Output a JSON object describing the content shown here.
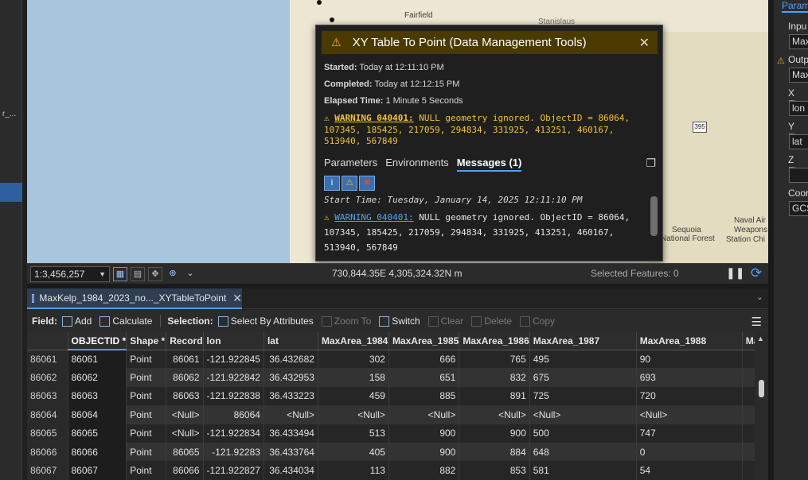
{
  "left_panel": {
    "truncated_text": "r_..."
  },
  "map": {
    "labels": [
      "Fairfield",
      "Stanislaus",
      "Sequoia",
      "National Forest",
      "Naval Air",
      "Weapons",
      "Station Chi"
    ],
    "road_shield": "395"
  },
  "map_status": {
    "scale": "1:3,456,257",
    "coordinates": "730,844.35E 4,305,324.32N m",
    "selected_features": "Selected Features: 0"
  },
  "table_tab": {
    "label": "MaxKelp_1984_2023_no..._XYTableToPoint"
  },
  "toolbar": {
    "field_label": "Field:",
    "add": "Add",
    "calculate": "Calculate",
    "selection_label": "Selection:",
    "select_by_attributes": "Select By Attributes",
    "zoom_to": "Zoom To",
    "switch": "Switch",
    "clear": "Clear",
    "delete": "Delete",
    "copy": "Copy"
  },
  "table": {
    "columns": [
      "",
      "OBJECTID *",
      "Shape *",
      "Record",
      "lon",
      "lat",
      "MaxArea_1984",
      "MaxArea_1985",
      "MaxArea_1986",
      "MaxArea_1987",
      "MaxArea_1988",
      "Max"
    ],
    "rows": [
      [
        "86061",
        "86061",
        "Point",
        "86061",
        "-121.922845",
        "36.432682",
        "302",
        "666",
        "765",
        "495",
        "90",
        ""
      ],
      [
        "86062",
        "86062",
        "Point",
        "86062",
        "-121.922842",
        "36.432953",
        "158",
        "651",
        "832",
        "675",
        "693",
        ""
      ],
      [
        "86063",
        "86063",
        "Point",
        "86063",
        "-121.922838",
        "36.433223",
        "459",
        "885",
        "891",
        "725",
        "720",
        ""
      ],
      [
        "86064",
        "86064",
        "Point",
        "<Null>",
        "86064",
        "<Null>",
        "<Null>",
        "<Null>",
        "<Null>",
        "<Null>",
        "<Null>",
        ""
      ],
      [
        "86065",
        "86065",
        "Point",
        "<Null>",
        "-121.922834",
        "36.433494",
        "513",
        "900",
        "900",
        "500",
        "747",
        ""
      ],
      [
        "86066",
        "86066",
        "Point",
        "86065",
        "-121.92283",
        "36.433764",
        "405",
        "900",
        "884",
        "648",
        "0",
        ""
      ],
      [
        "86067",
        "86067",
        "Point",
        "86066",
        "-121.922827",
        "36.434034",
        "113",
        "882",
        "853",
        "581",
        "54",
        ""
      ]
    ]
  },
  "popup": {
    "title": "XY Table To Point (Data Management Tools)",
    "started_label": "Started:",
    "started_value": "Today at 12:11:10 PM",
    "completed_label": "Completed:",
    "completed_value": "Today at 12:12:15 PM",
    "elapsed_label": "Elapsed Time:",
    "elapsed_value": "1 Minute 5 Seconds",
    "warning_code": "WARNING 040401:",
    "warning_text": "NULL geometry ignored. ObjectID = 86064, 107345, 185425, 217059, 294834, 331925, 413251, 460167, 513940, 567849",
    "tabs": [
      "Parameters",
      "Environments",
      "Messages (1)"
    ],
    "start_time": "Start Time: Tuesday, January 14, 2025 12:11:10 PM",
    "msg_warning_code": "WARNING 040401:",
    "msg_warning_text": "NULL geometry ignored. ObjectID = 86064, 107345, 185425, 217059, 294834, 331925, 413251, 460167, 513940, 567849"
  },
  "right_panel": {
    "header": "Param",
    "input_label": "Inpu",
    "input_value": "Max",
    "output_label": "Outp",
    "output_value": "Max",
    "x_label": "X Fie",
    "x_value": "lon",
    "y_label": "Y Fie",
    "y_value": "lat",
    "z_label": "Z Fie",
    "z_value": "",
    "coord_label": "Coor",
    "coord_value": "GCS"
  },
  "colors": {
    "accent": "#4ea1ff",
    "warning": "#f3b61f",
    "popup_header": "#4a3a00"
  }
}
